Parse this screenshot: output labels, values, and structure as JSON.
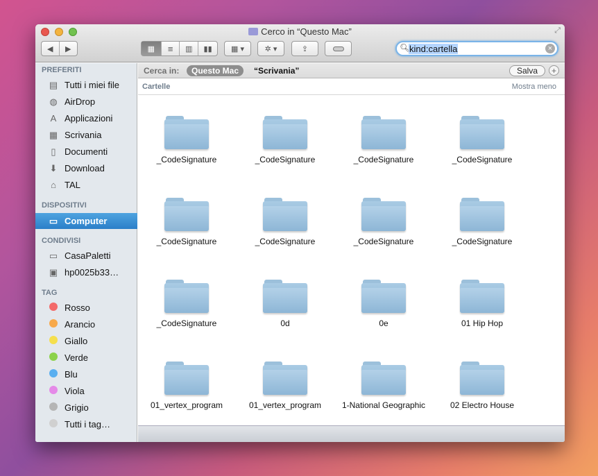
{
  "window": {
    "title": "Cerco in “Questo Mac”"
  },
  "toolbar": {
    "back": "◀",
    "forward": "▶",
    "search_value": "kind:cartella"
  },
  "scope": {
    "label": "Cerca in:",
    "selected": "Questo Mac",
    "other": "“Scrivania”",
    "save": "Salva",
    "add": "+"
  },
  "header": {
    "section": "Cartelle",
    "toggle": "Mostra meno"
  },
  "sidebar": {
    "favorites_heading": "PREFERITI",
    "favorites": [
      {
        "label": "Tutti i miei file",
        "icon": "all-files-icon"
      },
      {
        "label": "AirDrop",
        "icon": "airdrop-icon"
      },
      {
        "label": "Applicazioni",
        "icon": "applications-icon"
      },
      {
        "label": "Scrivania",
        "icon": "desktop-icon"
      },
      {
        "label": "Documenti",
        "icon": "documents-icon"
      },
      {
        "label": "Download",
        "icon": "download-icon"
      },
      {
        "label": "TAL",
        "icon": "home-icon"
      }
    ],
    "devices_heading": "DISPOSITIVI",
    "devices": [
      {
        "label": "Computer",
        "icon": "laptop-icon",
        "selected": true
      }
    ],
    "shared_heading": "CONDIVISI",
    "shared": [
      {
        "label": "CasaPaletti",
        "icon": "server-icon"
      },
      {
        "label": "hp0025b33…",
        "icon": "monitor-icon"
      }
    ],
    "tags_heading": "TAG",
    "tags": [
      {
        "label": "Rosso",
        "color": "#f36a6a"
      },
      {
        "label": "Arancio",
        "color": "#f8a94a"
      },
      {
        "label": "Giallo",
        "color": "#f5df4d"
      },
      {
        "label": "Verde",
        "color": "#8cd24a"
      },
      {
        "label": "Blu",
        "color": "#5aaff0"
      },
      {
        "label": "Viola",
        "color": "#e58ae8"
      },
      {
        "label": "Grigio",
        "color": "#b5b5b5"
      },
      {
        "label": "Tutti i tag…",
        "color": "#d0d0d0"
      }
    ]
  },
  "files": [
    "_CodeSignature",
    "_CodeSignature",
    "_CodeSignature",
    "_CodeSignature",
    "_CodeSignature",
    "_CodeSignature",
    "_CodeSignature",
    "_CodeSignature",
    "_CodeSignature",
    "0d",
    "0e",
    "01 Hip Hop",
    "01_vertex_program",
    "01_vertex_program",
    "1-National Geographic",
    "02 Electro House"
  ]
}
